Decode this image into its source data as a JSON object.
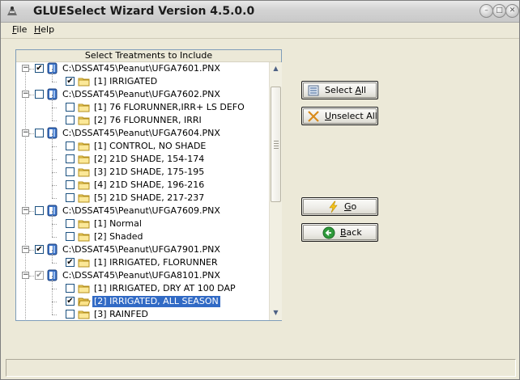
{
  "window": {
    "title": "GLUESelect Wizard Version 4.5.0.0"
  },
  "menu": [
    {
      "key": "F",
      "rest": "ile"
    },
    {
      "key": "H",
      "rest": "elp"
    }
  ],
  "panel": {
    "header": "Select Treatments to Include"
  },
  "tree": [
    {
      "kind": "file",
      "label": "C:\\DSSAT45\\Peanut\\UFGA7601.PNX",
      "checked": true,
      "grey": false
    },
    {
      "kind": "trt",
      "label": "[1] IRRIGATED",
      "checked": true
    },
    {
      "kind": "file",
      "label": "C:\\DSSAT45\\Peanut\\UFGA7602.PNX",
      "checked": false,
      "grey": false
    },
    {
      "kind": "trt",
      "label": "[1] 76 FLORUNNER,IRR+ LS DEFO",
      "checked": false
    },
    {
      "kind": "trt",
      "label": "[2] 76 FLORUNNER, IRRI",
      "checked": false
    },
    {
      "kind": "file",
      "label": "C:\\DSSAT45\\Peanut\\UFGA7604.PNX",
      "checked": false,
      "grey": false
    },
    {
      "kind": "trt",
      "label": "[1] CONTROL, NO SHADE",
      "checked": false
    },
    {
      "kind": "trt",
      "label": "[2] 21D SHADE, 154-174",
      "checked": false
    },
    {
      "kind": "trt",
      "label": "[3] 21D SHADE, 175-195",
      "checked": false
    },
    {
      "kind": "trt",
      "label": "[4] 21D SHADE, 196-216",
      "checked": false
    },
    {
      "kind": "trt",
      "label": "[5] 21D SHADE, 217-237",
      "checked": false
    },
    {
      "kind": "file",
      "label": "C:\\DSSAT45\\Peanut\\UFGA7609.PNX",
      "checked": false,
      "grey": false
    },
    {
      "kind": "trt",
      "label": "[1] Normal",
      "checked": false
    },
    {
      "kind": "trt",
      "label": "[2] Shaded",
      "checked": false
    },
    {
      "kind": "file",
      "label": "C:\\DSSAT45\\Peanut\\UFGA7901.PNX",
      "checked": true,
      "grey": false
    },
    {
      "kind": "trt",
      "label": "[1] IRRIGATED, FLORUNNER",
      "checked": true
    },
    {
      "kind": "file",
      "label": "C:\\DSSAT45\\Peanut\\UFGA8101.PNX",
      "checked": true,
      "grey": true
    },
    {
      "kind": "trt",
      "label": "[1] IRRIGATED, DRY AT 100 DAP",
      "checked": false
    },
    {
      "kind": "trt",
      "label": "[2] IRRIGATED, ALL SEASON",
      "checked": true,
      "selected": true
    },
    {
      "kind": "trt",
      "label": "[3] RAINFED",
      "checked": false
    }
  ],
  "buttons": {
    "select_all": {
      "pre": "Select ",
      "key": "A",
      "post": "ll",
      "icon": "select-all-icon"
    },
    "unselect_all": {
      "pre": "",
      "key": "U",
      "post": "nselect All",
      "icon": "cross-icon"
    },
    "go": {
      "pre": "",
      "key": "G",
      "post": "o",
      "icon": "lightning-icon"
    },
    "back": {
      "pre": "",
      "key": "B",
      "post": "ack",
      "icon": "back-arrow-icon"
    }
  },
  "colors": {
    "selection": "#316ac5",
    "window_bg": "#ECE9D8",
    "checkbox_border": "#1c5180"
  }
}
